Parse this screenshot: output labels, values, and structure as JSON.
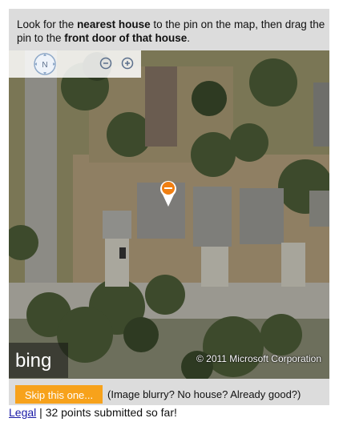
{
  "instruction": {
    "part1": "Look for the ",
    "bold1": "nearest house",
    "part2": " to the pin on the map, then drag the pin to the ",
    "bold2": "front door of that house",
    "part3": "."
  },
  "map": {
    "compass_letter": "N",
    "copyright": "© 2011 Microsoft Corporation",
    "logo_text": "bing"
  },
  "actions": {
    "skip_label": "Skip this one...",
    "help_text": "(Image blurry? No house? Already good?)"
  },
  "footer": {
    "legal_label": "Legal",
    "separator": " | ",
    "points_text": "32 points submitted so far!"
  },
  "colors": {
    "skip_button": "#f7a21b",
    "pin": "#f07f12",
    "link": "#1a1aa6"
  }
}
